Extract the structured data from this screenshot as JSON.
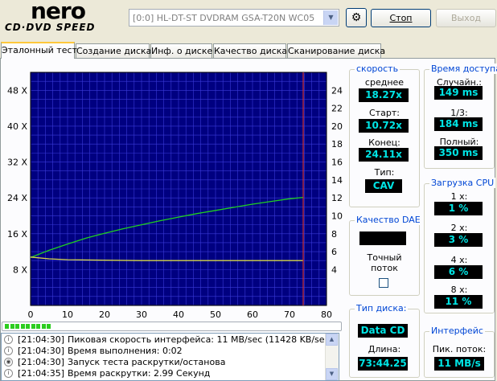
{
  "header": {
    "logo_top": "nero",
    "logo_bottom": "CD·DVD SPEED",
    "drive": "[0:0]   HL-DT-ST DVDRAM GSA-T20N WC05",
    "stop_label": "Стоп",
    "exit_label": "Выход"
  },
  "tabs": [
    {
      "label": "Эталонный тест",
      "active": true
    },
    {
      "label": "Создание диска"
    },
    {
      "label": "Инф. о диске"
    },
    {
      "label": "Качество диска"
    },
    {
      "label": "Сканирование диска"
    }
  ],
  "speed": {
    "title": "скорость",
    "avg_label": "среднее",
    "avg_value": "18.27x",
    "start_label": "Старт:",
    "start_value": "10.72x",
    "end_label": "Конец:",
    "end_value": "24.11x",
    "type_label": "Тип:",
    "type_value": "CAV"
  },
  "access": {
    "title": "Время доступа",
    "random_label": "Случайн.:",
    "random_value": "149 ms",
    "third_label": "1/3:",
    "third_value": "184 ms",
    "full_label": "Полный:",
    "full_value": "350 ms"
  },
  "cpu": {
    "title": "Загрузка CPU",
    "x1_label": "1 x:",
    "x1_value": "1 %",
    "x2_label": "2 x:",
    "x2_value": "3 %",
    "x4_label": "4 x:",
    "x4_value": "6 %",
    "x8_label": "8 x:",
    "x8_value": "11 %"
  },
  "dae": {
    "title": "Качество DAE",
    "value": "",
    "accurate_label": "Точный\nпоток"
  },
  "disc": {
    "title": "Тип диска:",
    "type_value": "Data CD",
    "length_label": "Длина:",
    "length_value": "73:44.25"
  },
  "interface": {
    "title": "Интерфейс",
    "burst_label": "Пик. поток:",
    "burst_value": "11 MB/s"
  },
  "progress": {
    "segments": 9
  },
  "log": [
    {
      "time": "[21:04:30]",
      "msg": "Пиковая скорость интерфейса: 11 MB/sec (11428 KB/sec)"
    },
    {
      "time": "[21:04:30]",
      "msg": "Время выполнения:  0:02"
    },
    {
      "time": "[21:04:30]",
      "msg": "Запуск теста раскрутки/останова"
    },
    {
      "time": "[21:04:35]",
      "msg": "Время раскрутки: 2.99 Секунд"
    }
  ],
  "chart_data": {
    "type": "line",
    "x_ticks": [
      0,
      10,
      20,
      30,
      40,
      50,
      60,
      70,
      80
    ],
    "y_left_ticks": [
      "8 X",
      "16 X",
      "24 X",
      "32 X",
      "40 X",
      "48 X"
    ],
    "y_right_ticks": [
      4,
      6,
      8,
      10,
      12,
      14,
      16,
      18,
      20,
      22,
      24
    ],
    "xlim": [
      0,
      80
    ],
    "ylim_left": [
      0,
      52
    ],
    "ylim_right": [
      0,
      26
    ],
    "end_marker_x": 73.7,
    "colors": {
      "background": "#000080",
      "grid": "#3a3ad8",
      "speed": "#20d020",
      "rpm": "#d8d84a",
      "marker": "#d03030"
    },
    "series": [
      {
        "axis": "left",
        "color": "#20d020",
        "x": [
          0,
          5,
          10,
          15,
          20,
          25,
          30,
          35,
          40,
          45,
          50,
          55,
          60,
          65,
          70,
          73.7
        ],
        "y": [
          10.7,
          12.3,
          13.7,
          15.0,
          16.1,
          17.1,
          18.0,
          18.9,
          19.7,
          20.5,
          21.2,
          21.9,
          22.6,
          23.2,
          23.8,
          24.1
        ]
      },
      {
        "axis": "right",
        "color": "#d8d84a",
        "x": [
          0,
          5,
          10,
          20,
          30,
          40,
          50,
          60,
          70,
          73.7
        ],
        "y": [
          5.4,
          5.2,
          5.1,
          5.05,
          5.0,
          5.0,
          5.0,
          5.0,
          5.0,
          5.0
        ]
      }
    ]
  }
}
